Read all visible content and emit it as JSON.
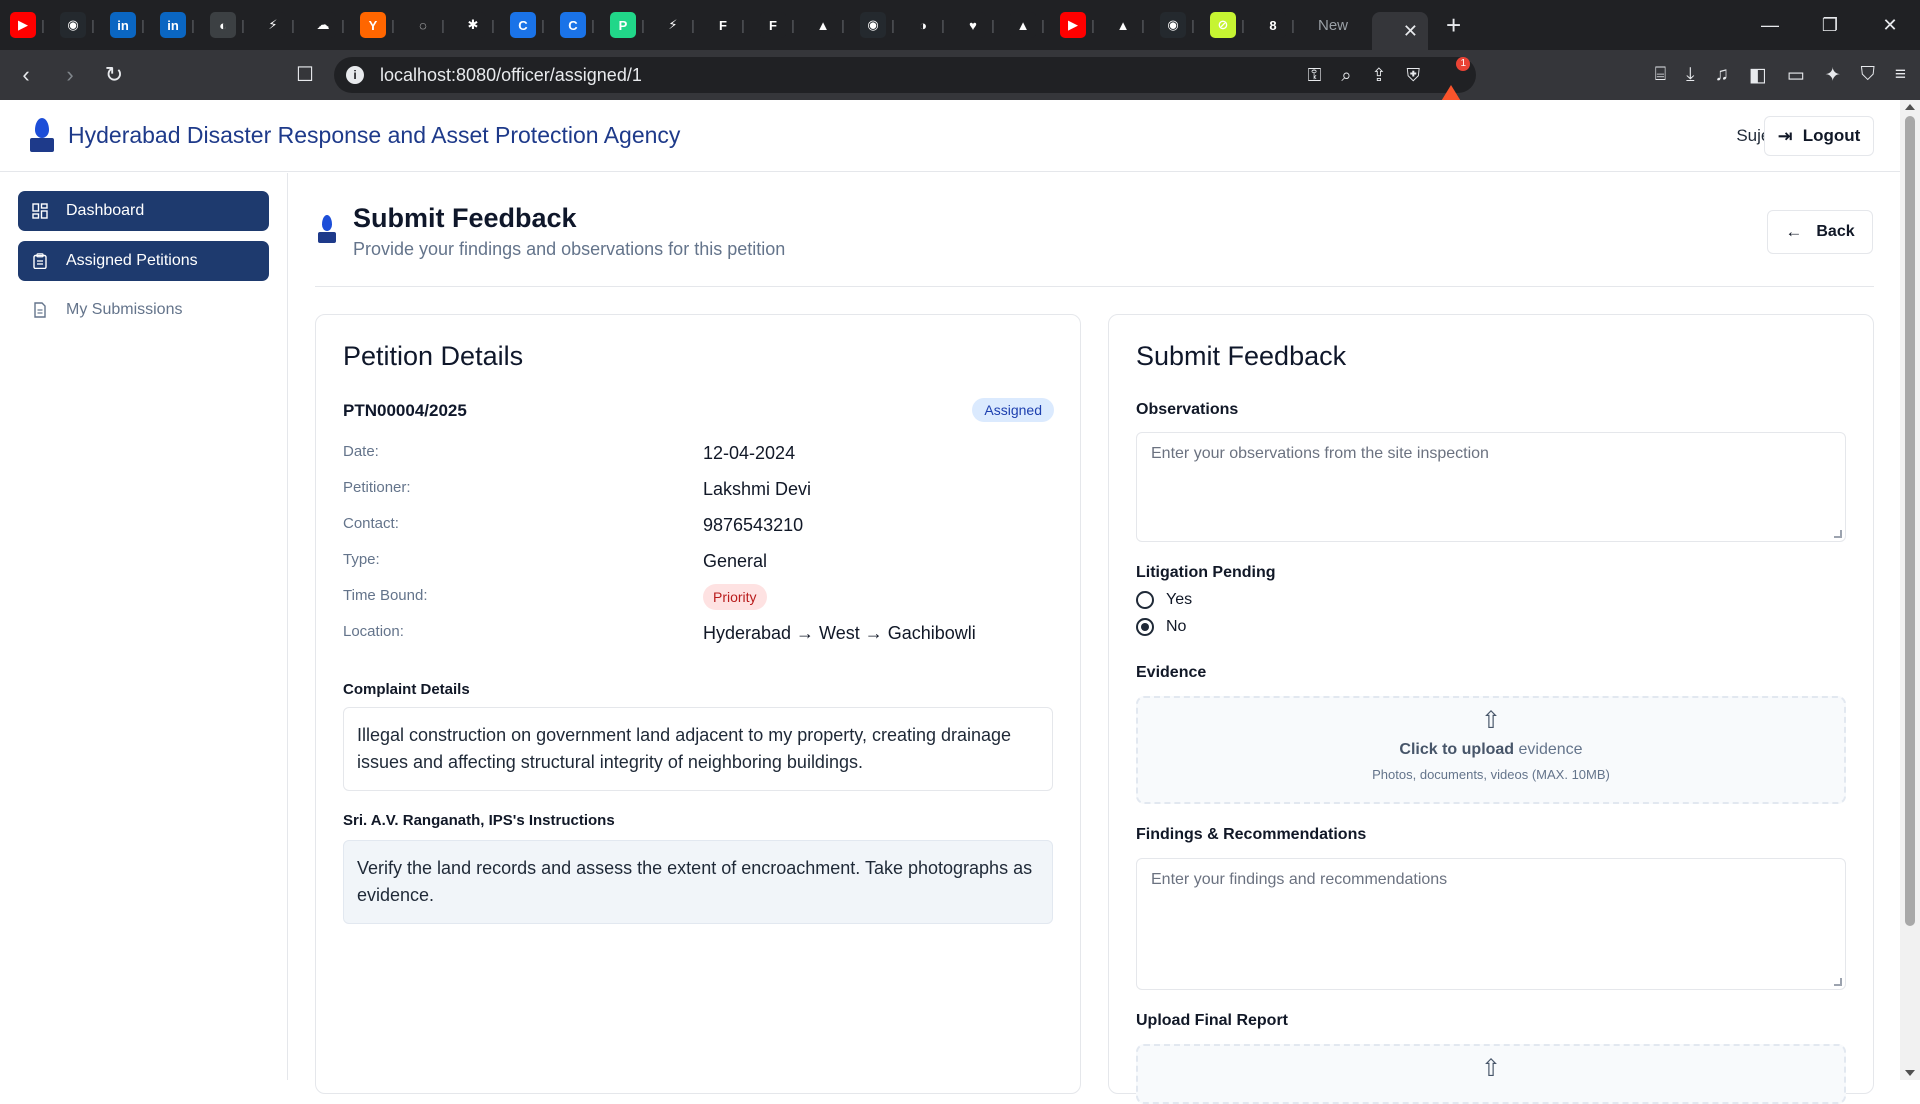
{
  "browser": {
    "tab_icons": [
      {
        "name": "youtube-icon",
        "color": "#ff0000",
        "glyph": "▶"
      },
      {
        "name": "github-icon",
        "color": "#24292e",
        "glyph": "◉"
      },
      {
        "name": "linkedin-icon",
        "color": "#0a66c2",
        "glyph": "in"
      },
      {
        "name": "linkedin-icon",
        "color": "#0a66c2",
        "glyph": "in"
      },
      {
        "name": "app-icon",
        "color": "#3c4043",
        "glyph": "◐"
      },
      {
        "name": "bolt-icon",
        "color": "#202124",
        "glyph": "⚡"
      },
      {
        "name": "drive-icon",
        "color": "#202124",
        "glyph": "☁"
      },
      {
        "name": "ycombinator-icon",
        "color": "#ff6600",
        "glyph": "Y"
      },
      {
        "name": "swirl-icon",
        "color": "#202124",
        "glyph": "◌"
      },
      {
        "name": "openai-icon",
        "color": "#202124",
        "glyph": "✱"
      },
      {
        "name": "c-icon",
        "color": "#1a73e8",
        "glyph": "C"
      },
      {
        "name": "c-icon",
        "color": "#1a73e8",
        "glyph": "C"
      },
      {
        "name": "pycharm-icon",
        "color": "#21d789",
        "glyph": "P"
      },
      {
        "name": "bolt-icon",
        "color": "#202124",
        "glyph": "⚡"
      },
      {
        "name": "framer-icon",
        "color": "#202124",
        "glyph": "F"
      },
      {
        "name": "framer-icon",
        "color": "#202124",
        "glyph": "F"
      },
      {
        "name": "vercel-icon",
        "color": "#202124",
        "glyph": "▲"
      },
      {
        "name": "github-icon",
        "color": "#24292e",
        "glyph": "◉"
      },
      {
        "name": "app-icon",
        "color": "#202124",
        "glyph": "◑"
      },
      {
        "name": "heart-icon",
        "color": "#202124",
        "glyph": "♥"
      },
      {
        "name": "vercel-icon",
        "color": "#202124",
        "glyph": "▲"
      },
      {
        "name": "youtube-icon",
        "color": "#ff0000",
        "glyph": "▶"
      },
      {
        "name": "vercel-icon",
        "color": "#202124",
        "glyph": "▲"
      },
      {
        "name": "github-icon",
        "color": "#24292e",
        "glyph": "◉"
      },
      {
        "name": "app-icon",
        "color": "#c6f432",
        "glyph": "⊘"
      },
      {
        "name": "app-icon",
        "color": "#202124",
        "glyph": "8"
      }
    ],
    "new_tab_label": "New",
    "url": "localhost:8080/officer/assigned/1",
    "brave_count": "1"
  },
  "header": {
    "agency": "Hyderabad Disaster Response and Asset Protection Agency",
    "user": "Sujeeth",
    "logout": "Logout"
  },
  "sidebar": {
    "items": [
      {
        "label": "Dashboard"
      },
      {
        "label": "Assigned Petitions"
      },
      {
        "label": "My Submissions"
      }
    ]
  },
  "page": {
    "title": "Submit Feedback",
    "subtitle": "Provide your findings and observations for this petition",
    "back": "Back"
  },
  "petition": {
    "heading": "Petition Details",
    "number": "PTN00004/2025",
    "status": "Assigned",
    "fields": {
      "date_label": "Date:",
      "date": "12-04-2024",
      "petitioner_label": "Petitioner:",
      "petitioner": "Lakshmi Devi",
      "contact_label": "Contact:",
      "contact": "9876543210",
      "type_label": "Type:",
      "type": "General",
      "timebound_label": "Time Bound:",
      "timebound": "Priority",
      "location_label": "Location:",
      "location": "Hyderabad → West → Gachibowli"
    },
    "complaint_label": "Complaint Details",
    "complaint": "Illegal construction on government land adjacent to my property, creating drainage issues and affecting structural integrity of neighboring buildings.",
    "instructions_label": "Sri. A.V. Ranganath, IPS's Instructions",
    "instructions": "Verify the land records and assess the extent of encroachment. Take photographs as evidence."
  },
  "feedback": {
    "heading": "Submit Feedback",
    "observations_label": "Observations",
    "observations_placeholder": "Enter your observations from the site inspection",
    "litigation_label": "Litigation Pending",
    "yes": "Yes",
    "no": "No",
    "litigation_selected": "No",
    "evidence_label": "Evidence",
    "upload_bold": "Click to upload",
    "upload_rest": " evidence",
    "upload_hint": "Photos, documents, videos (MAX. 10MB)",
    "findings_label": "Findings & Recommendations",
    "findings_placeholder": "Enter your findings and recommendations",
    "final_report_label": "Upload Final Report"
  }
}
